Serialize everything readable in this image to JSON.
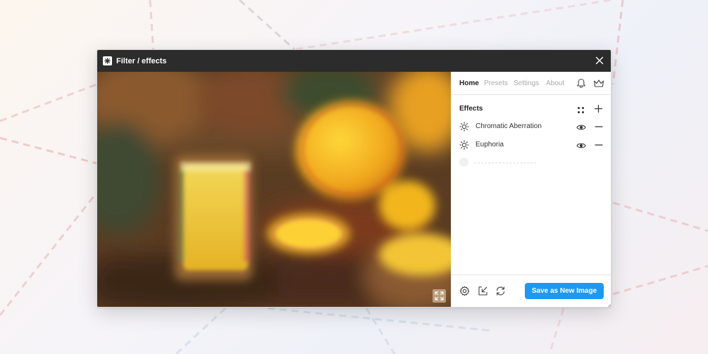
{
  "window": {
    "title": "Filter / effects"
  },
  "icons": {
    "app": "filter-app-icon",
    "close": "close-icon",
    "expand": "expand-icon",
    "bell": "bell-icon",
    "crown": "crown-icon",
    "dots": "dots-grid-icon",
    "plus": "plus-icon",
    "sun": "sun-icon",
    "eye": "eye-icon",
    "minus": "minus-icon",
    "gear": "gear-icon",
    "import": "import-icon",
    "refresh": "refresh-icon"
  },
  "tabs": [
    {
      "label": "Home",
      "active": true
    },
    {
      "label": "Presets",
      "active": false
    },
    {
      "label": "Settings",
      "active": false
    },
    {
      "label": "About",
      "active": false
    }
  ],
  "effects": {
    "title": "Effects",
    "items": [
      {
        "label": "Chromatic Aberration",
        "visible": true
      },
      {
        "label": "Euphoria",
        "visible": true
      }
    ]
  },
  "footer": {
    "save_label": "Save as New Image"
  },
  "colors": {
    "titlebar": "#2c2c2c",
    "accent": "#1e98f0",
    "active_tab": "#222222",
    "inactive_tab": "#aaaaaa"
  }
}
